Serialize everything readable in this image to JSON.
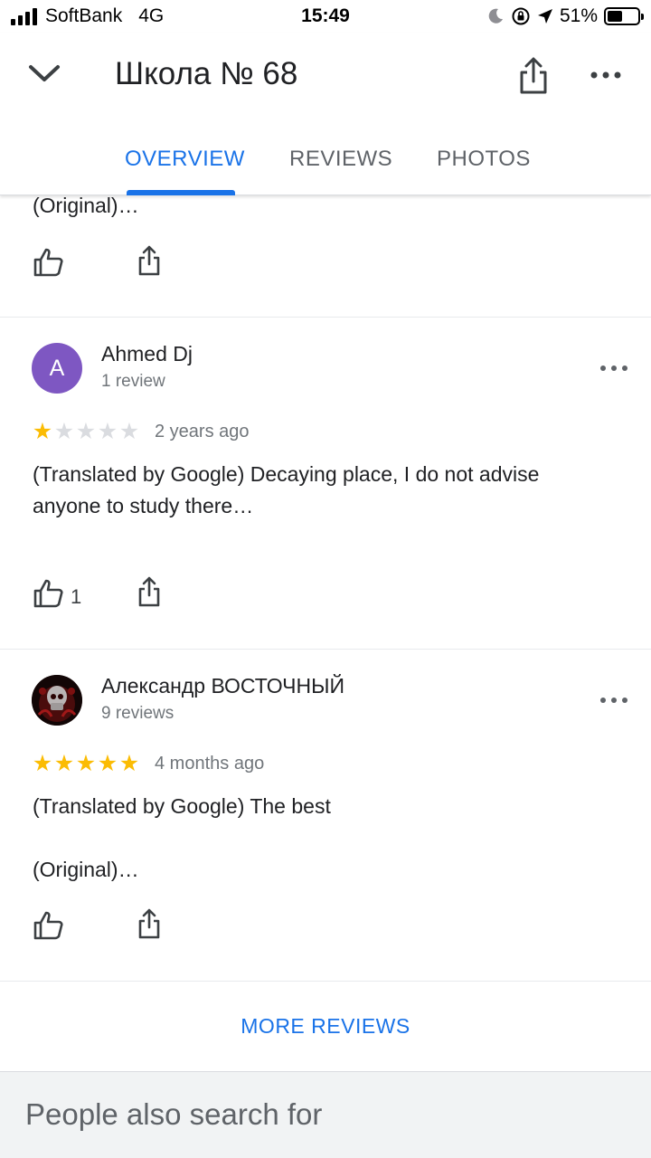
{
  "status_bar": {
    "carrier": "SoftBank",
    "network": "4G",
    "time": "15:49",
    "battery": "51%",
    "battery_level": 0.51
  },
  "header": {
    "title": "Школа № 68",
    "tabs": [
      {
        "label": "OVERVIEW",
        "active": true
      },
      {
        "label": "REVIEWS",
        "active": false
      },
      {
        "label": "PHOTOS",
        "active": false
      }
    ]
  },
  "prev_review": {
    "text": "(Original)…"
  },
  "reviews": [
    {
      "name": "Ahmed Dj",
      "avatar_letter": "A",
      "avatar_color": "#7e57c2",
      "count": "1 review",
      "rating": 1,
      "date": "2 years ago",
      "text_lines": [
        "(Translated by Google) Decaying place, I do not advise",
        "anyone to study there…"
      ],
      "likes": "1"
    },
    {
      "name": "Александр ВОСТОЧНЫЙ",
      "count": "9 reviews",
      "rating": 5,
      "date": "4 months ago",
      "text": "(Translated by Google) The best",
      "original": "(Original)…"
    }
  ],
  "more_reviews": "MORE REVIEWS",
  "people_also_search": "People also search for",
  "colors": {
    "accent": "#1a73e8",
    "star": "#fbbc04"
  }
}
